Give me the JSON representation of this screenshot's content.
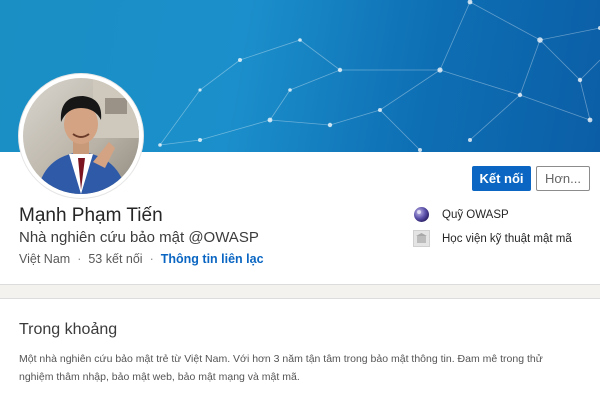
{
  "profile": {
    "name": "Mạnh Phạm Tiến",
    "headline": "Nhà nghiên cứu bảo mật @OWASP",
    "location": "Việt Nam",
    "separator": "·",
    "connections": "53 kết nối",
    "contact_info": "Thông tin liên lạc",
    "avatar_icon": "user-avatar-photo"
  },
  "actions": {
    "connect_label": "Kết nối",
    "more_label": "Hơn..."
  },
  "side_panel": {
    "items": [
      {
        "label": "Quỹ OWASP",
        "icon": "owasp-logo-icon"
      },
      {
        "label": "Học viện kỹ thuật mật mã",
        "icon": "school-logo-icon"
      }
    ]
  },
  "about": {
    "title": "Trong khoảng",
    "text": "Một nhà nghiên cứu bảo mật trẻ từ Việt Nam. Với hơn 3 năm tận tâm trong bảo mật thông tin. Đam mê trong thử nghiệm thâm nhập, bảo mật web, bảo mật mạng và mật mã."
  },
  "colors": {
    "accent": "#0a66c2",
    "banner": "#1b8fcb",
    "background": "#f3f2ef"
  }
}
